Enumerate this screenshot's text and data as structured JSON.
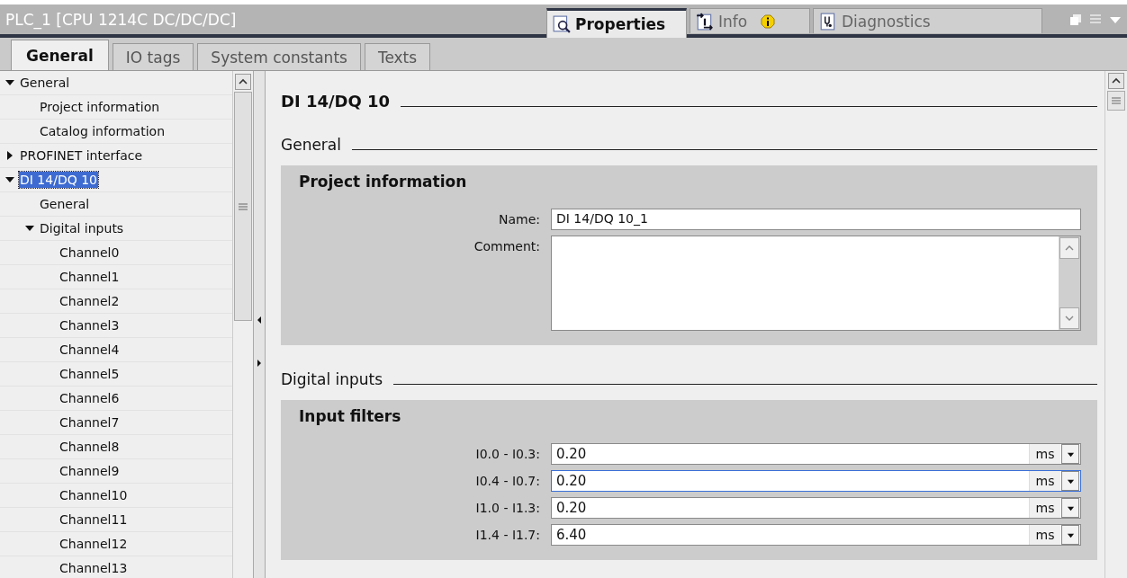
{
  "window": {
    "title": "PLC_1 [CPU 1214C DC/DC/DC]"
  },
  "inspector_tabs": [
    {
      "label": "Properties",
      "selected": true,
      "info_badge": false
    },
    {
      "label": "Info",
      "selected": false,
      "info_badge": true
    },
    {
      "label": "Diagnostics",
      "selected": false,
      "info_badge": false
    }
  ],
  "tabs": [
    {
      "label": "General",
      "selected": true
    },
    {
      "label": "IO tags",
      "selected": false
    },
    {
      "label": "System constants",
      "selected": false
    },
    {
      "label": "Texts",
      "selected": false
    }
  ],
  "tree": [
    {
      "label": "General",
      "expanded": true,
      "selected": false,
      "children": [
        {
          "label": "Project information",
          "selected": false
        },
        {
          "label": "Catalog information",
          "selected": false
        }
      ]
    },
    {
      "label": "PROFINET interface",
      "expanded": false,
      "selected": false
    },
    {
      "label": "DI 14/DQ 10",
      "expanded": true,
      "selected": true,
      "children": [
        {
          "label": "General",
          "selected": false
        },
        {
          "label": "Digital inputs",
          "expanded": true,
          "selected": false,
          "children": [
            {
              "label": "Channel0",
              "selected": false
            },
            {
              "label": "Channel1",
              "selected": false
            },
            {
              "label": "Channel2",
              "selected": false
            },
            {
              "label": "Channel3",
              "selected": false
            },
            {
              "label": "Channel4",
              "selected": false
            },
            {
              "label": "Channel5",
              "selected": false
            },
            {
              "label": "Channel6",
              "selected": false
            },
            {
              "label": "Channel7",
              "selected": false
            },
            {
              "label": "Channel8",
              "selected": false
            },
            {
              "label": "Channel9",
              "selected": false
            },
            {
              "label": "Channel10",
              "selected": false
            },
            {
              "label": "Channel11",
              "selected": false
            },
            {
              "label": "Channel12",
              "selected": false
            },
            {
              "label": "Channel13",
              "selected": false
            }
          ]
        }
      ]
    }
  ],
  "content": {
    "heading": "DI 14/DQ 10",
    "sections": [
      {
        "title": "General",
        "panel": {
          "title": "Project information",
          "fields": [
            {
              "kind": "text",
              "label": "Name:",
              "value": "DI 14/DQ 10_1",
              "focused": false
            },
            {
              "kind": "textarea",
              "label": "Comment:",
              "focused": false
            }
          ]
        }
      },
      {
        "title": "Digital inputs",
        "panel": {
          "title": "Input filters",
          "fields": [
            {
              "kind": "unit",
              "label": "I0.0 - I0.3:",
              "value": "0.20",
              "unit": "ms",
              "focused": false
            },
            {
              "kind": "unit",
              "label": "I0.4 - I0.7:",
              "value": "0.20",
              "unit": "ms",
              "focused": true
            },
            {
              "kind": "unit",
              "label": "I1.0 - I1.3:",
              "value": "0.20",
              "unit": "ms",
              "focused": false
            },
            {
              "kind": "unit",
              "label": "I1.4 - I1.7:",
              "value": "6.40",
              "unit": "ms",
              "focused": false
            }
          ]
        }
      }
    ]
  }
}
